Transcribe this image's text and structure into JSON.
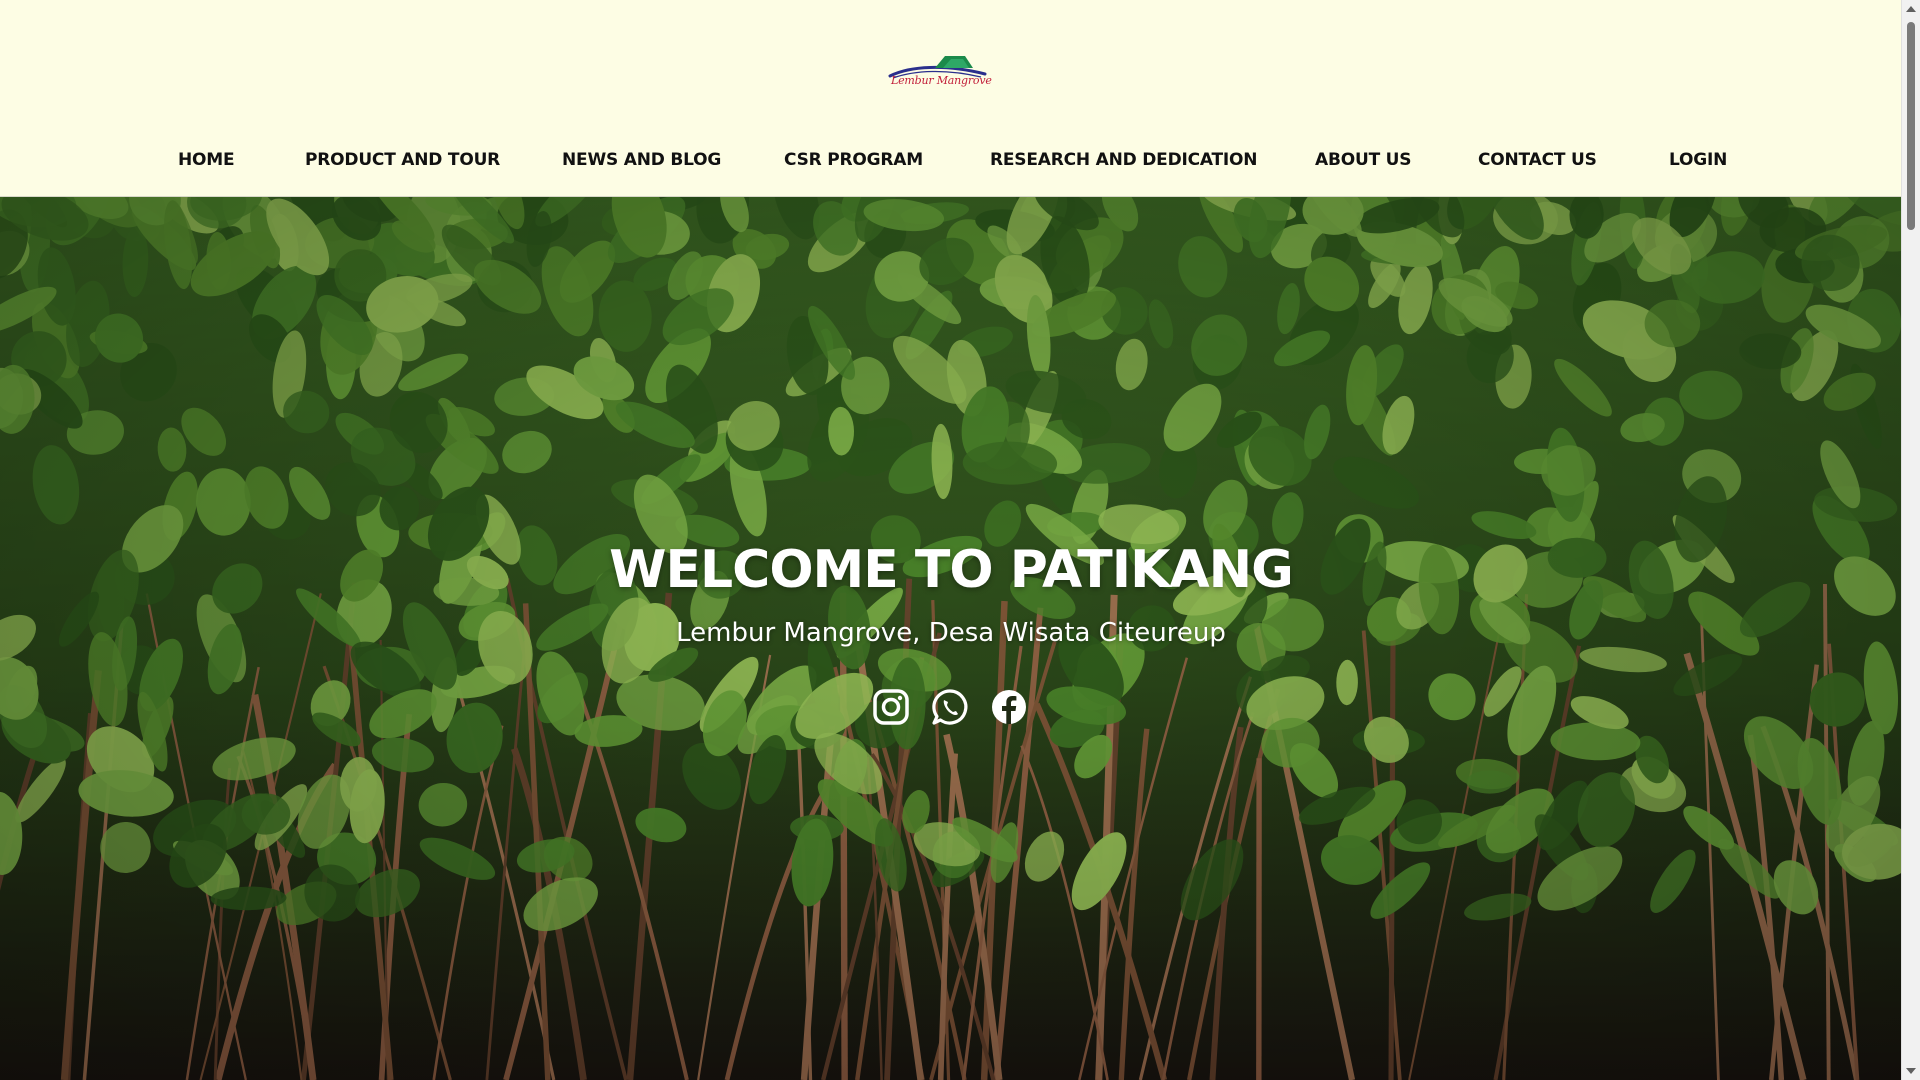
{
  "brand": {
    "logo_text": "Lembur Mangrove",
    "colors": {
      "roof": "#1b8a4a",
      "swoosh": "#2a2f8c",
      "text": "#c21f3a"
    }
  },
  "nav": {
    "items": [
      {
        "label": "HOME"
      },
      {
        "label": "PRODUCT AND TOUR"
      },
      {
        "label": "NEWS AND BLOG"
      },
      {
        "label": "CSR PROGRAM"
      },
      {
        "label": "RESEARCH AND DEDICATION"
      },
      {
        "label": "ABOUT US"
      },
      {
        "label": "CONTACT US"
      },
      {
        "label": "LOGIN"
      }
    ]
  },
  "hero": {
    "title": "WELCOME TO PATIKANG",
    "subtitle": "Lembur Mangrove, Desa Wisata Citeureup",
    "background": "mangrove-forest-photo",
    "socials": [
      {
        "icon": "instagram-icon"
      },
      {
        "icon": "whatsapp-icon"
      },
      {
        "icon": "facebook-icon"
      }
    ]
  },
  "theme": {
    "header_bg": "#fdfde4",
    "nav_text": "#111111",
    "hero_text": "#ffffff"
  }
}
